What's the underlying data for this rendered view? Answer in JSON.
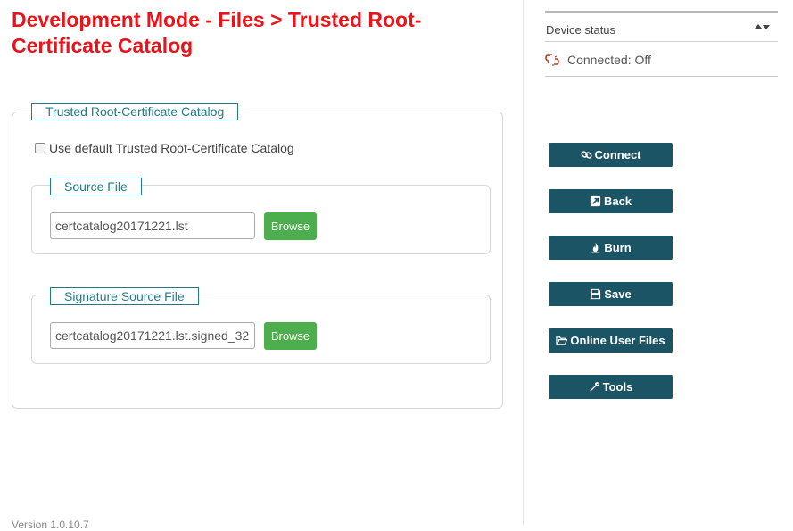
{
  "page": {
    "title": "Development Mode - Files > Trusted Root-Certificate Catalog",
    "version": "Version 1.0.10.7"
  },
  "catalog": {
    "legend": "Trusted Root-Certificate Catalog",
    "use_default_label": "Use default Trusted Root-Certificate Catalog",
    "use_default_checked": false,
    "source": {
      "legend": "Source File",
      "value": "certcatalog20171221.lst",
      "browse_label": "Browse"
    },
    "signature": {
      "legend": "Signature Source File",
      "value": "certcatalog20171221.lst.signed_32",
      "browse_label": "Browse"
    }
  },
  "device_status": {
    "title": "Device status",
    "status_text": "Connected: Off",
    "status_icon": "unlink-icon"
  },
  "actions": [
    {
      "label": "Connect",
      "icon": "link-icon"
    },
    {
      "label": "Back",
      "icon": "back-icon"
    },
    {
      "label": "Burn",
      "icon": "flame-icon"
    },
    {
      "label": "Save",
      "icon": "save-icon"
    },
    {
      "label": "Online User Files",
      "icon": "folder-open-icon"
    },
    {
      "label": "Tools",
      "icon": "wrench-icon"
    }
  ],
  "colors": {
    "title_red": "#e8141b",
    "legend_teal": "#1f7a8c",
    "action_button": "#1b5565",
    "browse_green": "#4cae4c"
  }
}
